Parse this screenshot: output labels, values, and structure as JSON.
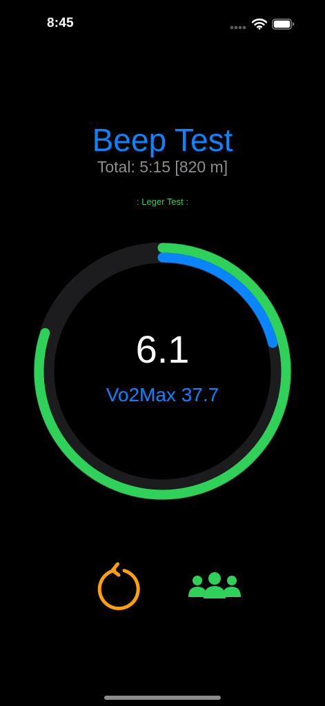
{
  "status_bar": {
    "time": "8:45",
    "icons": [
      "signal-dots-icon",
      "wifi-icon",
      "battery-icon"
    ]
  },
  "header": {
    "title": "Beep Test",
    "total": "Total: 5:15 [820 m]",
    "test_type": ": Leger Test :"
  },
  "progress": {
    "level": "6.1",
    "vo2max": "Vo2Max 37.7",
    "outer_fraction": 0.8,
    "inner_fraction": 0.21
  },
  "actions": {
    "reset_icon": "reset-icon",
    "participants_icon": "group-icon"
  },
  "colors": {
    "background": "#000000",
    "accent_blue": "#0a84ff",
    "accent_green": "#30d158",
    "accent_orange": "#ff9f0a",
    "track": "#1c1c1e",
    "secondary_text": "#8e8e93"
  }
}
